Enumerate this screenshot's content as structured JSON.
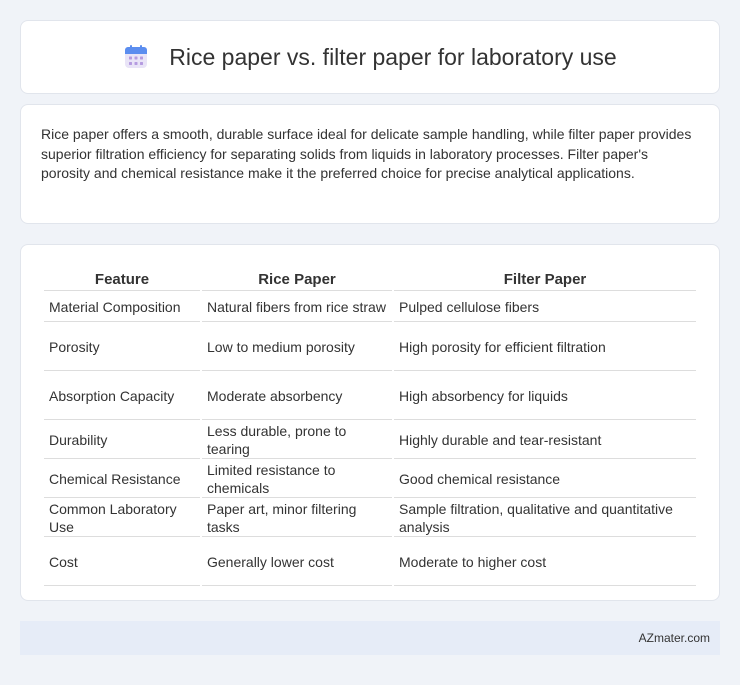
{
  "header": {
    "title": "Rice paper vs. filter paper for laboratory use",
    "icon": "calendar-icon"
  },
  "summary": "Rice paper offers a smooth, durable surface ideal for delicate sample handling, while filter paper provides superior filtration efficiency for separating solids from liquids in laboratory processes. Filter paper's porosity and chemical resistance make it the preferred choice for precise analytical applications.",
  "table": {
    "headers": [
      "Feature",
      "Rice Paper",
      "Filter Paper"
    ],
    "rows": [
      [
        "Material Composition",
        "Natural fibers from rice straw",
        "Pulped cellulose fibers"
      ],
      [
        "Porosity",
        "Low to medium porosity",
        "High porosity for efficient filtration"
      ],
      [
        "Absorption Capacity",
        "Moderate absorbency",
        "High absorbency for liquids"
      ],
      [
        "Durability",
        "Less durable, prone to tearing",
        "Highly durable and tear-resistant"
      ],
      [
        "Chemical Resistance",
        "Limited resistance to chemicals",
        "Good chemical resistance"
      ],
      [
        "Common Laboratory Use",
        "Paper art, minor filtering tasks",
        "Sample filtration, qualitative and quantitative analysis"
      ],
      [
        "Cost",
        "Generally lower cost",
        "Moderate to higher cost"
      ]
    ]
  },
  "footer": {
    "source": "AZmater.com"
  }
}
